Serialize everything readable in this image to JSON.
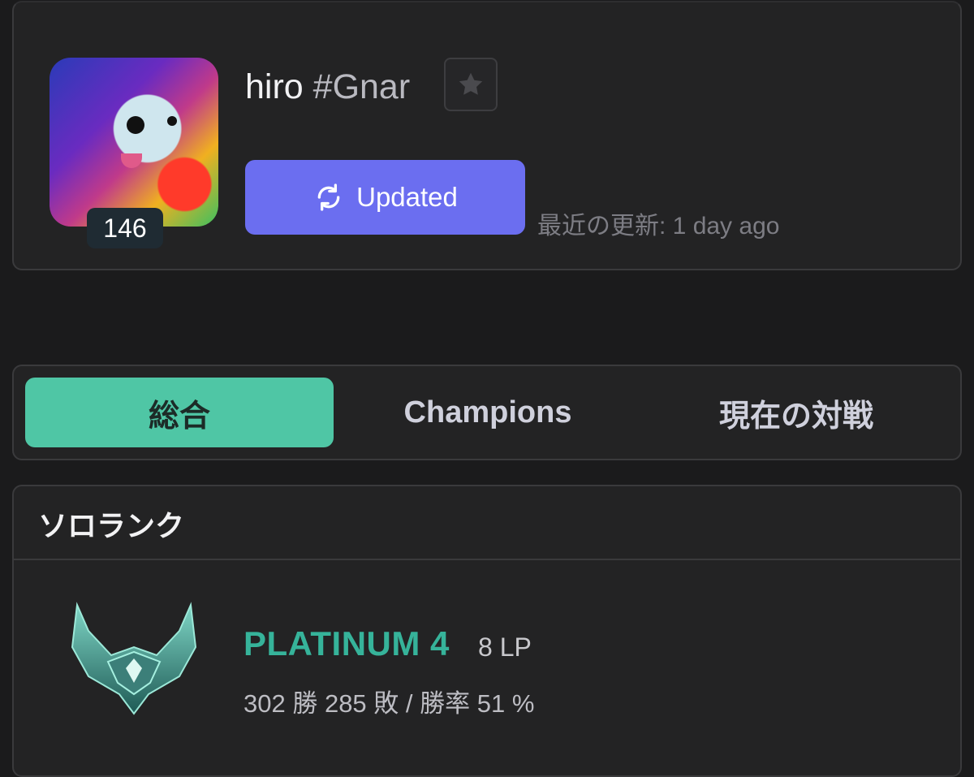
{
  "profile": {
    "name": "hiro",
    "tag": "#Gnar",
    "level": "146",
    "update_button_label": "Updated",
    "last_update": "最近の更新: 1 day ago"
  },
  "tabs": [
    {
      "label": "総合",
      "active": true
    },
    {
      "label": "Champions",
      "active": false
    },
    {
      "label": "現在の対戦",
      "active": false
    }
  ],
  "ranked": {
    "title": "ソロランク",
    "tier": "PLATINUM 4",
    "lp": "8 LP",
    "record": "302 勝 285 敗 / 勝率 51 %"
  },
  "colors": {
    "accent_button": "#6b6ef0",
    "active_tab": "#4fc6a5",
    "tier_text": "#36b39a"
  }
}
